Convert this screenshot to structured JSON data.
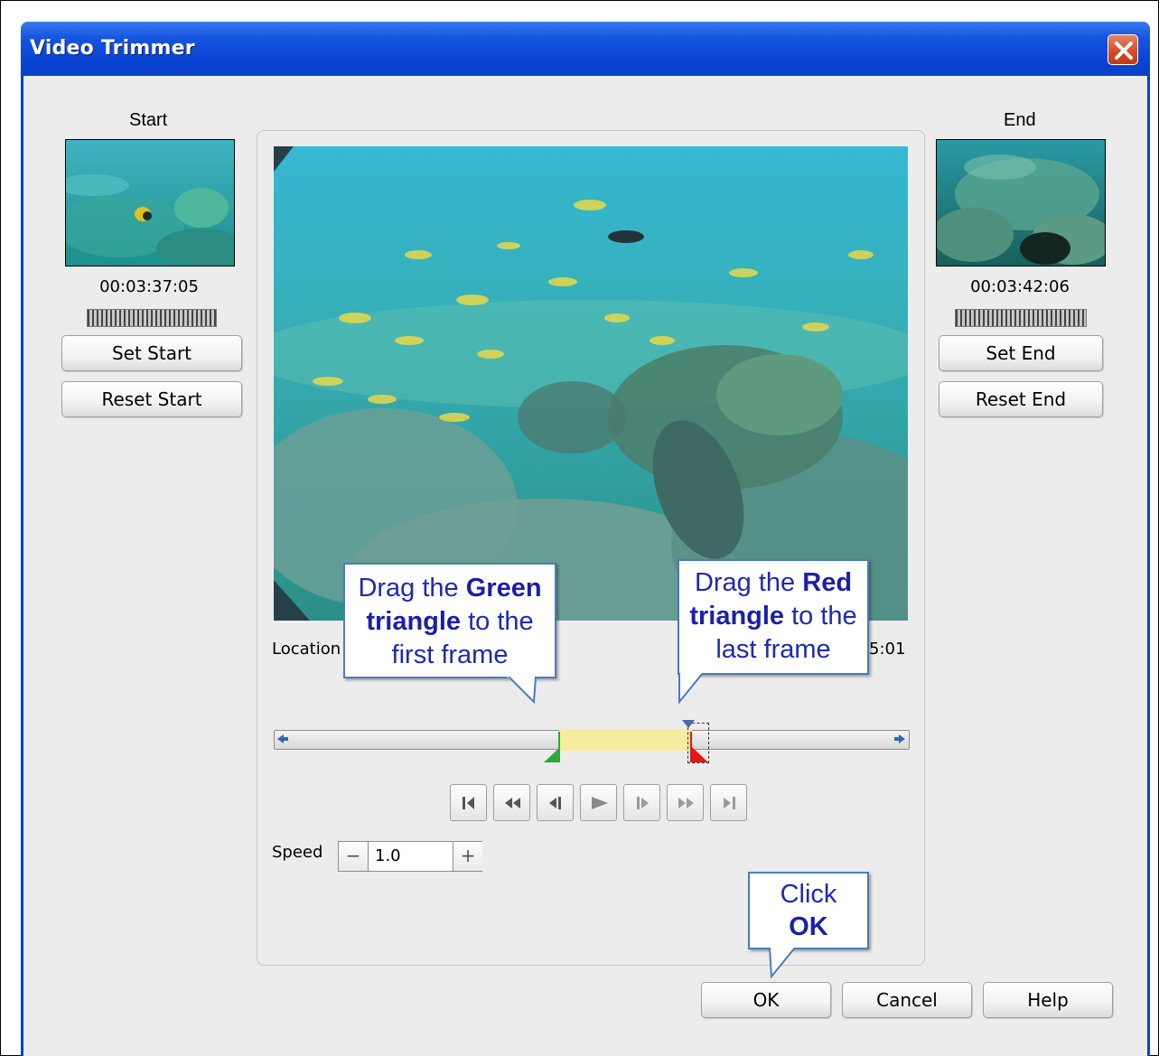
{
  "window": {
    "title": "Video Trimmer"
  },
  "start": {
    "heading": "Start",
    "timecode": "00:03:37:05",
    "set_label": "Set Start",
    "reset_label": "Reset Start"
  },
  "end": {
    "heading": "End",
    "timecode": "00:03:42:06",
    "set_label": "Set End",
    "reset_label": "Reset End"
  },
  "location": {
    "label": "Location",
    "time_fragment": "5:01"
  },
  "speed": {
    "label": "Speed",
    "value": "1.0",
    "minus": "−",
    "plus": "+"
  },
  "transport": [
    "go-to-start-icon",
    "rewind-icon",
    "step-back-icon",
    "play-icon",
    "step-forward-icon",
    "fast-forward-icon",
    "go-to-end-icon"
  ],
  "footer": {
    "ok_label": "OK",
    "cancel_label": "Cancel",
    "help_label": "Help"
  },
  "callouts": {
    "green": {
      "pre": "Drag the ",
      "bold1": "Green",
      "bold2": "triangle",
      "post": " to the",
      "line3": "first frame"
    },
    "red": {
      "pre": "Drag the ",
      "bold1": "Red",
      "bold2": "triangle",
      "post": " to the",
      "line3": "last frame"
    },
    "ok": {
      "line1": "Click",
      "bold": "OK"
    }
  },
  "colors": {
    "title_bar": "#0a44d4",
    "client_bg": "#ececec",
    "callout_text": "#1e29b3",
    "selection": "#f7eba0",
    "green_marker": "#2fa83a",
    "red_marker": "#e01818"
  }
}
